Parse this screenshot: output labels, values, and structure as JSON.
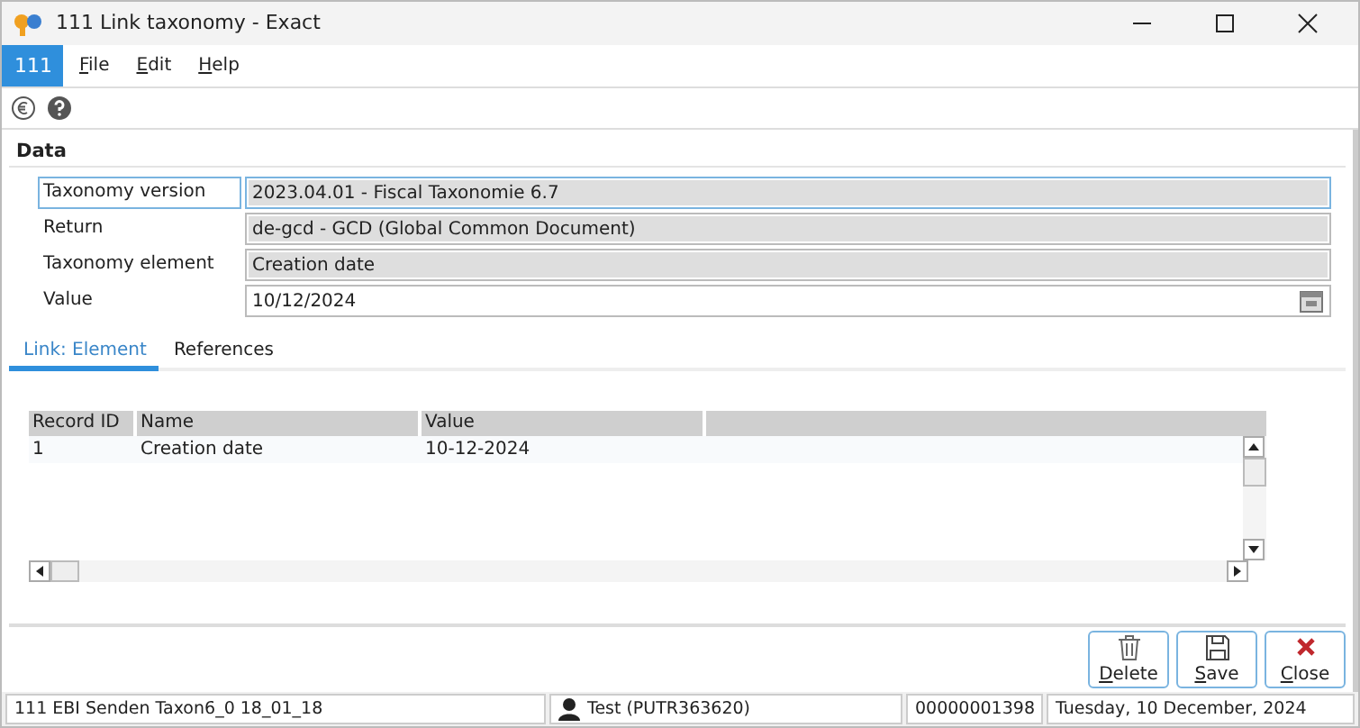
{
  "window": {
    "title": "111 Link taxonomy - Exact"
  },
  "menu": {
    "badge": "111",
    "items": [
      {
        "label": "File"
      },
      {
        "label": "Edit"
      },
      {
        "label": "Help"
      }
    ]
  },
  "section": {
    "title": "Data"
  },
  "fields": [
    {
      "label": "Taxonomy version",
      "value": "2023.04.01 - Fiscal Taxonomie 6.7",
      "kind": "readonly",
      "focused": true
    },
    {
      "label": "Return",
      "value": "de-gcd - GCD (Global Common Document)",
      "kind": "readonly",
      "focused": false
    },
    {
      "label": "Taxonomy element",
      "value": "Creation date",
      "kind": "readonly",
      "focused": false
    },
    {
      "label": "Value",
      "value": "10/12/2024",
      "kind": "date",
      "focused": false
    }
  ],
  "tabs": [
    {
      "label": "Link: Element",
      "selected": true
    },
    {
      "label": "References",
      "selected": false
    }
  ],
  "table": {
    "columns": [
      "Record ID",
      "Name",
      "Value"
    ],
    "rows": [
      [
        "1",
        "Creation date",
        "10-12-2024"
      ]
    ]
  },
  "buttons": [
    {
      "label": "Delete",
      "kind": "delete"
    },
    {
      "label": "Save",
      "kind": "save"
    },
    {
      "label": "Close",
      "kind": "close"
    }
  ],
  "status_bar": {
    "company": "111 EBI Senden Taxon6_0 18_01_18",
    "user": "Test (PUTR363620)",
    "number": "00000001398",
    "date": "Tuesday, 10 December, 2024"
  }
}
